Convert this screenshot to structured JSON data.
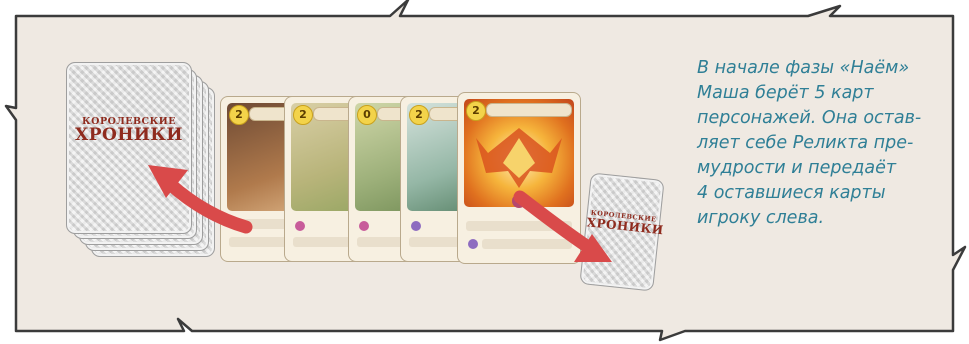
{
  "deck": {
    "title_line1": "КОРОЛЕВСКИЕ",
    "title_line2": "ХРОНИКИ"
  },
  "caption_lines": [
    "В начале фазы «Наём»",
    "Маша берёт 5 карт",
    "персонажей. Она остав-",
    "ляет себе Реликта пре-",
    "мудрости и передаёт",
    "4 оставшиеся карты",
    "игроку слева."
  ],
  "cards": [
    {
      "cost": "2",
      "art_colors": [
        "#8b5a3c",
        "#c98d58"
      ]
    },
    {
      "cost": "2",
      "art_colors": [
        "#c9b98a",
        "#9fb06a"
      ]
    },
    {
      "cost": "0",
      "art_colors": [
        "#b7c08f",
        "#8fa36b"
      ]
    },
    {
      "cost": "2",
      "art_colors": [
        "#b9d0c8",
        "#5f8a6a"
      ]
    },
    {
      "cost": "2",
      "art_colors": [
        "#f2a93a",
        "#d9561f"
      ]
    }
  ],
  "colors": {
    "border": "#3b3b3b",
    "panel": "#efe9e2",
    "arrow": "#d94a4a",
    "caption": "#2f7f96",
    "title": "#8f2b1e"
  }
}
